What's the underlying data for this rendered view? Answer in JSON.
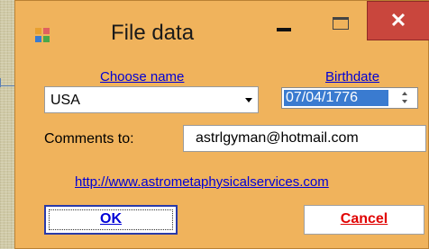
{
  "window": {
    "title": "File data",
    "close_glyph": "✕",
    "icons": {
      "app": "form-app-icon",
      "minimize": "minimize-icon",
      "maximize": "maximize-icon",
      "close": "close-icon"
    }
  },
  "form": {
    "choose_name_label": "Choose name",
    "birthdate_label": "Birthdate",
    "name_selected": "USA",
    "birthdate_value": "07/04/1776",
    "comments_label": "Comments to:",
    "email_value": "astrlgyman@hotmail.com",
    "website_link": "http://www.astrometaphysicalservices.com",
    "ok_label": "OK",
    "cancel_label": "Cancel"
  },
  "colors": {
    "window_bg": "#f0b35c",
    "link": "#0000d6",
    "cancel_text": "#e00000",
    "close_button": "#c9463d",
    "date_selection": "#3a7bd0"
  }
}
